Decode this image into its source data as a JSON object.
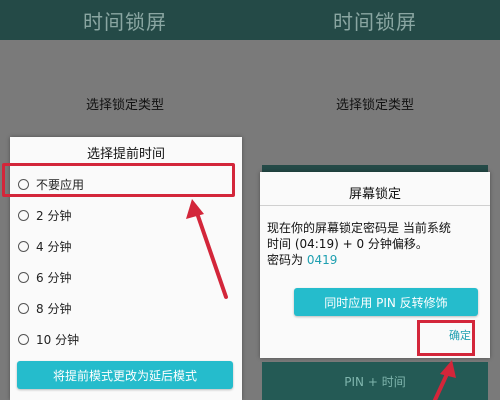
{
  "left": {
    "app_title": "时间锁屏",
    "subtitle": "选择锁定类型",
    "dialog": {
      "title": "选择提前时间",
      "options": [
        {
          "label": "不要应用"
        },
        {
          "label": "2 分钟"
        },
        {
          "label": "4 分钟"
        },
        {
          "label": "6 分钟"
        },
        {
          "label": "8 分钟"
        },
        {
          "label": "10 分钟"
        }
      ],
      "mode_button": "将提前模式更改为延后模式"
    }
  },
  "right": {
    "app_title": "时间锁屏",
    "subtitle": "选择锁定类型",
    "dialog": {
      "title": "屏幕锁定",
      "message_line1": "现在你的屏幕锁定密码是 当前系统",
      "message_line2": "时间 (04:19) + 0 分钟偏移。",
      "message_line3_prefix": "密码为 ",
      "pin": "0419",
      "reverse_button": "同时应用 PIN 反转修饰",
      "confirm_button": "确定"
    },
    "bottom_button": "PIN + 时间"
  },
  "colors": {
    "app_bar": "#244a47",
    "accent_teal": "#25bccc",
    "highlight_red": "#d3263a",
    "overlay_gray": "#7a7a7a"
  }
}
